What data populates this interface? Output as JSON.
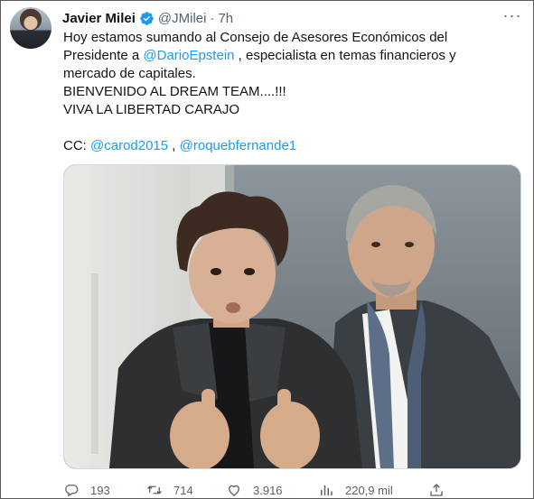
{
  "tweet": {
    "author_name": "Javier Milei",
    "handle": "@JMilei",
    "separator": "·",
    "time": "7h",
    "more_label": "···",
    "line1": "Hoy estamos sumando al Consejo de Asesores Económicos del",
    "line2_pre": "Presidente a ",
    "line2_mention": "@DarioEpstein",
    "line2_post": " , especialista en temas financieros y",
    "line3": "mercado de capitales.",
    "line4": "BIENVENIDO AL DREAM TEAM....!!!",
    "line5": "VIVA LA LIBERTAD CARAJO",
    "cc_label": "CC: ",
    "cc_mention1": "@carod2015",
    "cc_sep": " , ",
    "cc_mention2": "@roquebfernande1"
  },
  "actions": {
    "replies": "193",
    "retweets": "714",
    "likes": "3.916",
    "views": "220,9 mil"
  },
  "icons": {
    "verified": "verified-badge-icon",
    "reply": "reply-icon",
    "retweet": "retweet-icon",
    "like": "heart-icon",
    "views": "views-icon",
    "share": "share-icon"
  },
  "colors": {
    "accent": "#1d9bf0",
    "secondary_text": "#536471",
    "text": "#0f1419"
  }
}
